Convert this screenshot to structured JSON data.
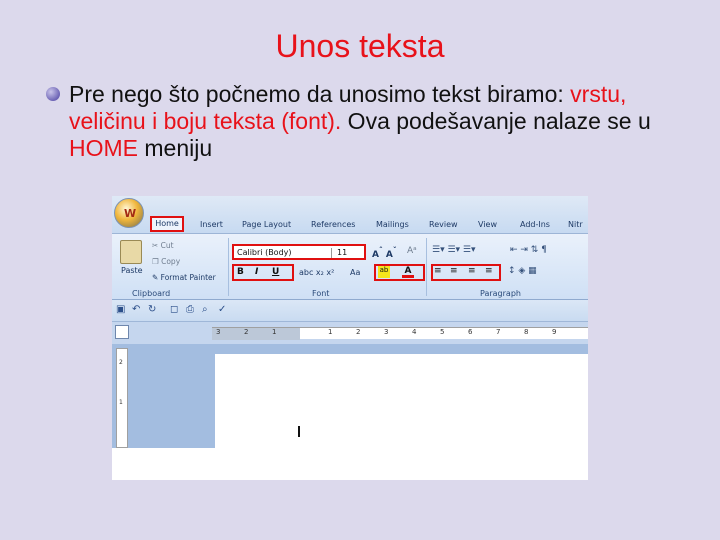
{
  "slide": {
    "title": "Unos teksta",
    "bullet": {
      "part1": "Pre nego što počnemo da unosimo tekst biramo: ",
      "highlight1": "vrstu, veličinu i boju teksta (font).",
      "part2": " Ova podešavanje nalaze se u ",
      "highlight2": "HOME",
      "part3": " meniju"
    }
  },
  "word": {
    "office_button": "W",
    "tabs": [
      "Home",
      "Insert",
      "Page Layout",
      "References",
      "Mailings",
      "Review",
      "View",
      "Add-Ins",
      "Nitr"
    ],
    "clipboard": {
      "paste": "Paste",
      "cut": "Cut",
      "copy": "Copy",
      "format_painter": "Format Painter",
      "group": "Clipboard"
    },
    "font": {
      "name": "Calibri (Body)",
      "size": "11",
      "group": "Font",
      "bold": "B",
      "italic": "I",
      "underline": "U"
    },
    "paragraph": {
      "group": "Paragraph"
    },
    "ruler_numbers": [
      "3",
      "2",
      "1",
      "1",
      "2",
      "3",
      "4",
      "5",
      "6",
      "7",
      "8",
      "9"
    ],
    "vruler_numbers": [
      "2",
      "1"
    ],
    "colors": {
      "highlight": "#f5e51c",
      "font_color": "#e01010",
      "accent_red": "#e8121a"
    }
  }
}
